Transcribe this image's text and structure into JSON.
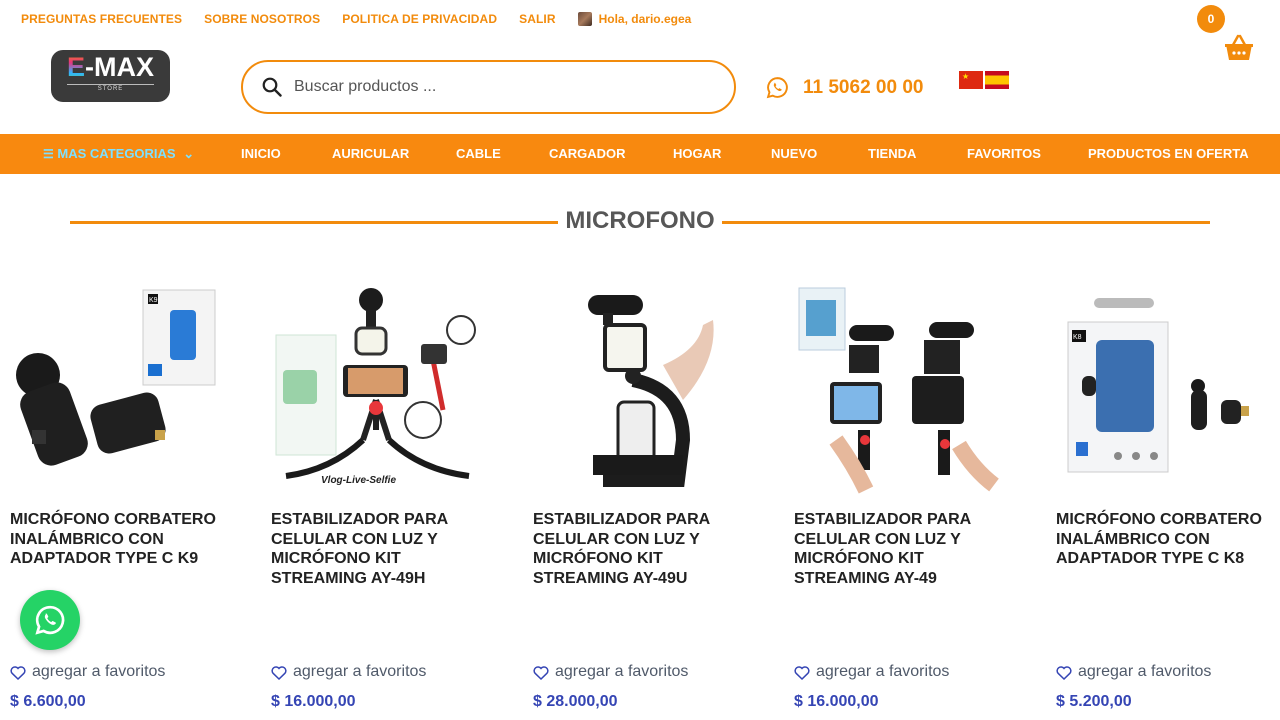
{
  "top_links": [
    "PREGUNTAS FRECUENTES",
    "SOBRE NOSOTROS",
    "POLITICA DE PRIVACIDAD",
    "SALIR"
  ],
  "greeting": "Hola, dario.egea",
  "cart": {
    "count": "0"
  },
  "logo": {
    "brand_first": "E",
    "brand_rest": "-MAX",
    "store": "STORE"
  },
  "search": {
    "placeholder": "Buscar productos ..."
  },
  "phone": "11 5062 00 00",
  "nav": {
    "categories": "MAS CATEGORIAS",
    "items": [
      "INICIO",
      "AURICULAR",
      "CABLE",
      "CARGADOR",
      "HOGAR",
      "NUEVO",
      "TIENDA",
      "FAVORITOS",
      "PRODUCTOS EN OFERTA"
    ]
  },
  "section_title": "MICROFONO",
  "favorite_label": "agregar a favoritos",
  "products": [
    {
      "name": "MICRÓFONO CORBATERO INALÁMBRICO CON ADAPTADOR TYPE C K9",
      "price": "$ 6.600,00",
      "image_text": "K9"
    },
    {
      "name": "ESTABILIZADOR PARA CELULAR CON LUZ Y MICRÓFONO KIT STREAMING AY-49H",
      "price": "$ 16.000,00",
      "image_text": "Vlog-Live-Selfie"
    },
    {
      "name": "ESTABILIZADOR PARA CELULAR CON LUZ Y MICRÓFONO KIT STREAMING AY-49U",
      "price": "$ 28.000,00"
    },
    {
      "name": "ESTABILIZADOR PARA CELULAR CON LUZ Y MICRÓFONO KIT STREAMING AY-49",
      "price": "$ 16.000,00"
    },
    {
      "name": "MICRÓFONO CORBATERO INALÁMBRICO CON ADAPTADOR TYPE C K8",
      "price": "$ 5.200,00",
      "image_text": "K8"
    }
  ],
  "colors": {
    "accent": "#f28b0c",
    "nav_bg": "#f8890f",
    "price": "#3545b4",
    "whatsapp": "#25d366"
  }
}
